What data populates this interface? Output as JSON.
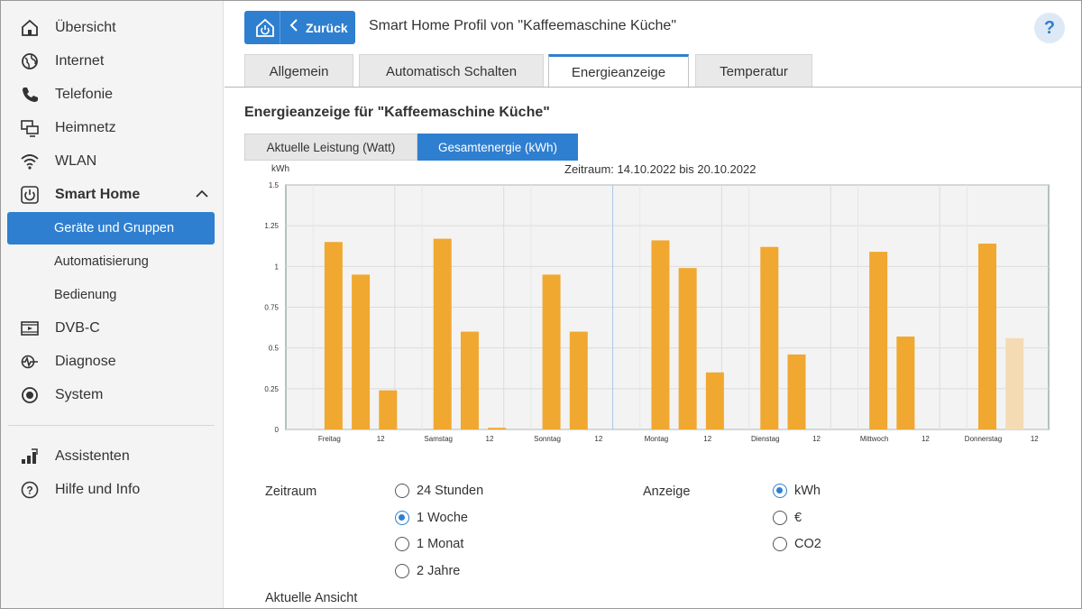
{
  "sidebar": {
    "items": [
      {
        "label": "Übersicht",
        "icon": "home-icon"
      },
      {
        "label": "Internet",
        "icon": "globe-icon"
      },
      {
        "label": "Telefonie",
        "icon": "phone-icon"
      },
      {
        "label": "Heimnetz",
        "icon": "network-icon"
      },
      {
        "label": "WLAN",
        "icon": "wifi-icon"
      },
      {
        "label": "Smart Home",
        "icon": "power-icon"
      }
    ],
    "sub_items": [
      {
        "label": "Geräte und Gruppen",
        "active": true
      },
      {
        "label": "Automatisierung",
        "active": false
      },
      {
        "label": "Bedienung",
        "active": false
      }
    ],
    "items2": [
      {
        "label": "DVB-C",
        "icon": "film-icon"
      },
      {
        "label": "Diagnose",
        "icon": "diagnose-icon"
      },
      {
        "label": "System",
        "icon": "system-icon"
      }
    ],
    "items3": [
      {
        "label": "Assistenten",
        "icon": "wizard-icon"
      },
      {
        "label": "Hilfe und Info",
        "icon": "help-circle-icon"
      }
    ]
  },
  "header": {
    "back_label": "Zurück",
    "title": "Smart Home Profil von \"Kaffeemaschine Küche\"",
    "help": "?"
  },
  "tabs": [
    {
      "label": "Allgemein",
      "active": false
    },
    {
      "label": "Automatisch Schalten",
      "active": false
    },
    {
      "label": "Energieanzeige",
      "active": true
    },
    {
      "label": "Temperatur",
      "active": false
    }
  ],
  "section_title": "Energieanzeige für \"Kaffeemaschine Küche\"",
  "toggle": {
    "left": "Aktuelle Leistung (Watt)",
    "right": "Gesamtenergie (kWh)"
  },
  "chart_data": {
    "type": "bar",
    "title": "Zeitraum: 14.10.2022 bis 20.10.2022",
    "ylabel": "kWh",
    "ylim": [
      0,
      1.5
    ],
    "yticks": [
      "0",
      "0.25",
      "0.5",
      "0.75",
      "1",
      "1.25",
      "1.5"
    ],
    "xtick_labels": [
      "Freitag",
      "12",
      "Samstag",
      "12",
      "Sonntag",
      "12",
      "Montag",
      "12",
      "Dienstag",
      "12",
      "Mittwoch",
      "12",
      "Donnerstag",
      "12"
    ],
    "values": [
      0,
      1.15,
      0.95,
      0.24,
      0,
      1.17,
      0.6,
      0.01,
      0,
      0.95,
      0.6,
      0,
      0,
      1.16,
      0.99,
      0.35,
      0,
      1.12,
      0.46,
      0,
      0,
      1.09,
      0.57,
      0,
      0,
      1.14,
      0.56
    ],
    "last_bar_faded": true,
    "bar_color": "#f0a830",
    "bar_color_faded": "#f5dbb4"
  },
  "options": {
    "zeitraum_label": "Zeitraum",
    "zeitraum": [
      {
        "label": "24 Stunden",
        "selected": false
      },
      {
        "label": "1 Woche",
        "selected": true
      },
      {
        "label": "1 Monat",
        "selected": false
      },
      {
        "label": "2 Jahre",
        "selected": false
      }
    ],
    "anzeige_label": "Anzeige",
    "anzeige": [
      {
        "label": "kWh",
        "selected": true
      },
      {
        "label": "€",
        "selected": false
      },
      {
        "label": "CO2",
        "selected": false
      }
    ],
    "aktuelle_ansicht": "Aktuelle Ansicht"
  }
}
